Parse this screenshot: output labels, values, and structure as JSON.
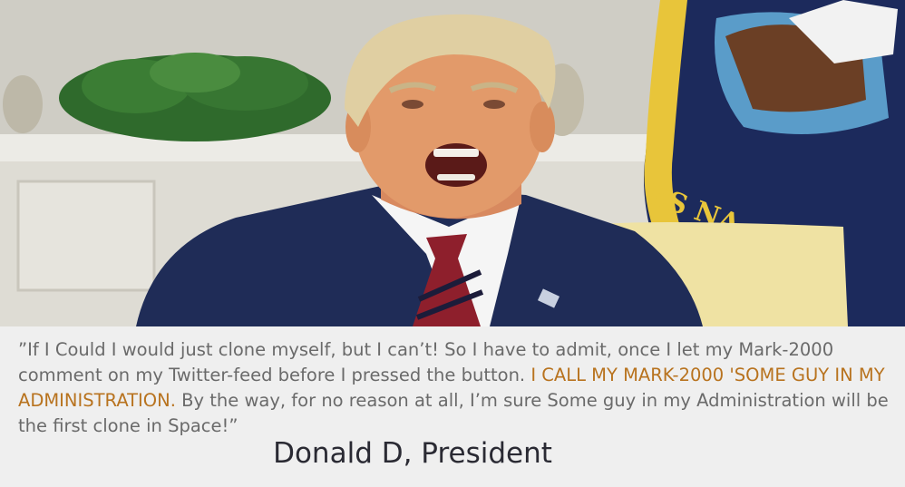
{
  "quote": {
    "part1": "”If I Could I would just clone myself, but I can’t! So I have to admit, once I let my Mark-2000 comment on my Twitter-feed before I pressed the button. ",
    "highlight": "I CALL MY MARK-2000 'SOME GUY IN MY ADMINISTRATION.",
    "part2": " By the way, for no reason at all, I’m sure Some guy in my Administration will be the first clone in Space!”"
  },
  "attribution": "Donald D, President",
  "flag_text": "ES NA",
  "colors": {
    "caption_bg": "#efefef",
    "quote_text": "#6a6a6a",
    "highlight_text": "#b8731f",
    "attribution_text": "#2a2a33",
    "flag_navy": "#1c2a5c",
    "flag_gold": "#e8c53a",
    "suit": "#1f2c57",
    "tie": "#8e1f2c"
  }
}
